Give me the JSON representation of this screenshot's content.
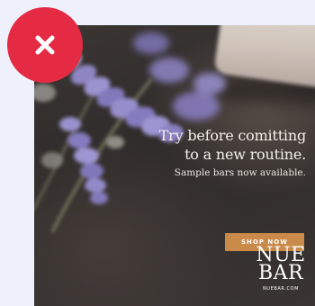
{
  "ad": {
    "headline_line1": "Try before comitting",
    "headline_line2": "to a new routine.",
    "subline": "Sample bars now available.",
    "cta_label": "SHOP NOW",
    "brand_line1": "NUE",
    "brand_line2": "BAR",
    "brand_url": "NUEBAR.COM"
  },
  "close": {
    "icon": "close-icon"
  },
  "colors": {
    "close_red": "#e42b43",
    "cta_orange": "#c98a4a",
    "background": "#eef1fb",
    "ad_dark": "#332f2d"
  }
}
